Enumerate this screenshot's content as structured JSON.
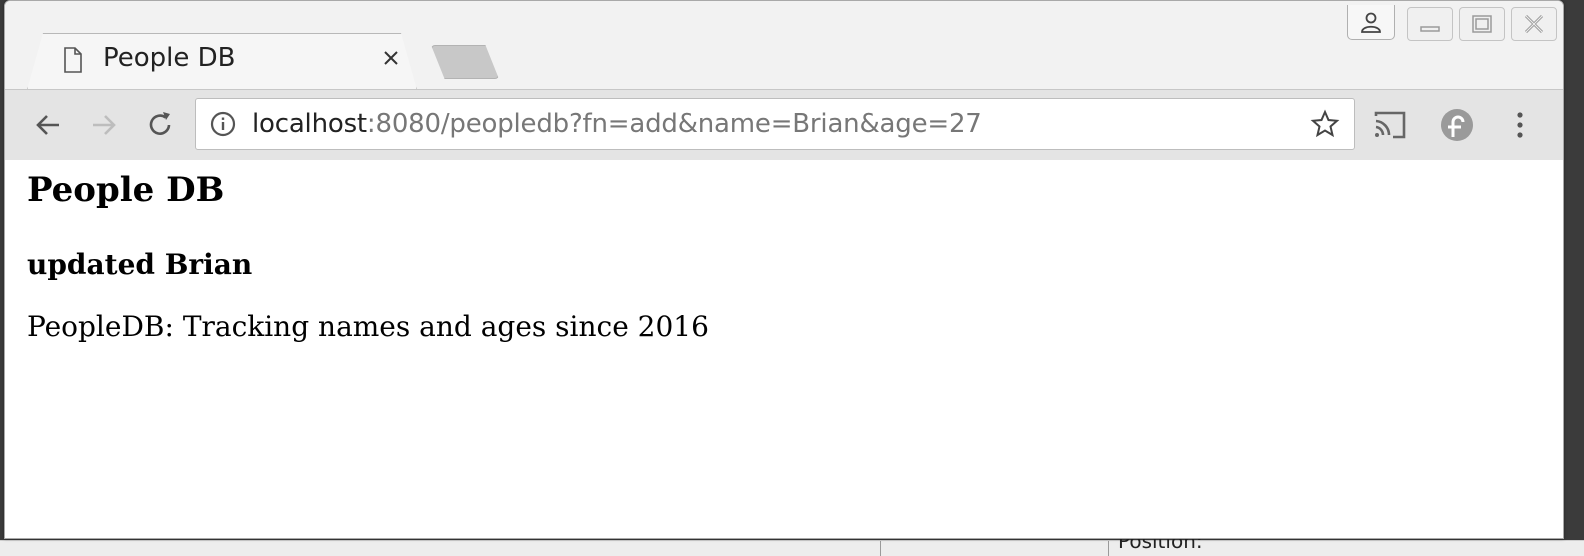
{
  "window": {
    "tab": {
      "title": "People DB",
      "icon": "document-icon"
    },
    "colors": {
      "frame": "#f2f2f2",
      "toolbar": "#e4e4e4",
      "url_muted": "#777777"
    }
  },
  "omnibox": {
    "host": "localhost",
    "rest": ":8080/peopledb?fn=add&name=Brian&age=27"
  },
  "page": {
    "heading": "People DB",
    "status": "updated Brian",
    "tagline": "PeopleDB: Tracking names and ages since 2016"
  },
  "background": {
    "partial_text": "Position:"
  }
}
